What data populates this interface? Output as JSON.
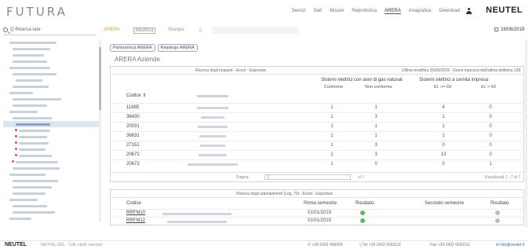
{
  "app": {
    "logo": "FUTURA",
    "brand": "NEUTEL",
    "nav": [
      "Servizi",
      "Dati",
      "Misure",
      "Reportistica",
      "ARERA",
      "Anagrafica",
      "Download"
    ],
    "active_nav_index": 4
  },
  "sidebar": {
    "search_label": "Q Ricerca rete",
    "items_count": 34,
    "selected_index": 13
  },
  "toolbar": {
    "items": [
      "ARERA",
      "Modifica",
      "Stampa"
    ],
    "date": "19/06/2019"
  },
  "main": {
    "tabs": [
      "Panoramica ARERA",
      "Riepilogo ARERA"
    ],
    "title": "ARERA Aziende",
    "panel1": {
      "header_link": "Ricerca degli impianti - Excel - Esportare",
      "updated": "Ultimo modifica 25/06/2019 - Giorni trascorsi dall'ultima delibera 138",
      "group1": "Sistemi elettrici con anni di gas naturali",
      "group2": "Sistemi elettrici a cernita impresa",
      "col_code": "Codice",
      "cols": [
        "Conforme",
        "Non conforme",
        "El. >= 60",
        "El. < 60"
      ],
      "rows": [
        {
          "code": "11865",
          "vals": [
            "1",
            "1",
            "4",
            "0"
          ]
        },
        {
          "code": "36430",
          "vals": [
            "1",
            "3",
            "1",
            "0"
          ]
        },
        {
          "code": "20031",
          "vals": [
            "1",
            "1",
            "1",
            "0"
          ]
        },
        {
          "code": "36631",
          "vals": [
            "1",
            "1",
            "1",
            "0"
          ]
        },
        {
          "code": "27151",
          "vals": [
            "1",
            "3",
            "0",
            "0"
          ]
        },
        {
          "code": "20672",
          "vals": [
            "1",
            "3",
            "13",
            "0"
          ]
        },
        {
          "code": "20672",
          "vals": [
            "1",
            "0",
            "0",
            "1"
          ]
        }
      ],
      "pager_label": "Pagina",
      "pager_value": "1",
      "pager_of": "di 1",
      "count": "Visualizzati 1 - 7 di 7"
    },
    "panel2": {
      "header_link": "Ricerca degli adempimenti (Leg. 70) - Excel - Esportare",
      "cols": [
        "Codice",
        "Prima semestre",
        "Risultato",
        "Secondo semestre",
        "Risultato"
      ],
      "rows": [
        {
          "code": "RRFM10",
          "date": "01/01/2019",
          "status1_color": "#5cb85c",
          "status2_color": "#bdbdbd"
        },
        {
          "code": "RRFM12",
          "date": "01/01/2019",
          "status1_color": "#5cb85c",
          "status2_color": "#bdbdbd"
        }
      ]
    }
  },
  "footer": {
    "brand": "NEUTEL",
    "sub": "NEUTEL SRL - Tutti i diritti riservati",
    "phone": "+39 0432 465000",
    "tel2": "Tel +39 0432 6660111",
    "fax": "Fax +39 0432 6660111",
    "email": "info@neutel.it"
  }
}
